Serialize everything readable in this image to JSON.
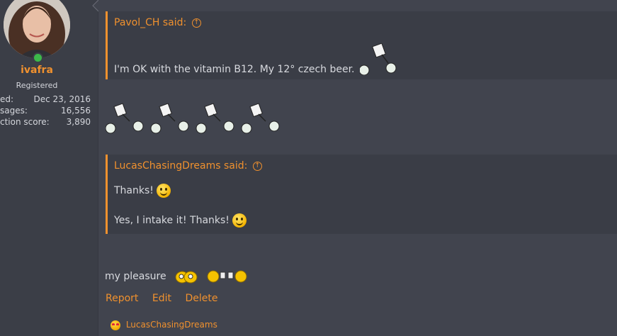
{
  "user": {
    "name": "ivafra",
    "title": "Registered",
    "stats": [
      {
        "label": "ed:",
        "value": "Dec 23, 2016"
      },
      {
        "label": "sages:",
        "value": "16,556"
      },
      {
        "label": "ction score:",
        "value": "3,890"
      }
    ]
  },
  "quote1": {
    "author": "Pavol_CH said:",
    "text": "I'm OK with the vitamin B12. My 12° czech beer."
  },
  "quote2": {
    "author": "LucasChasingDreams said:",
    "line1": "Thanks!",
    "line2": "Yes, I intake it! Thanks!"
  },
  "post": {
    "text": "my pleasure"
  },
  "actions": {
    "report": "Report",
    "edit": "Edit",
    "delete": "Delete"
  },
  "reaction": {
    "user": "LucasChasingDreams"
  },
  "colors": {
    "accent": "#f0912e",
    "background": "#41444e",
    "sidebar": "#3b3e47",
    "quote_bg": "#3a3d46"
  }
}
